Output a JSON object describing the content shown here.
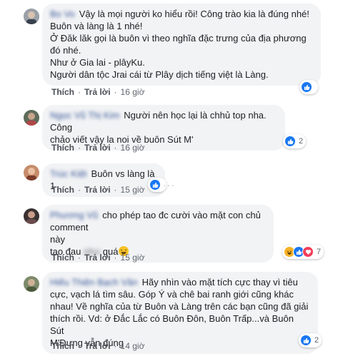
{
  "actions": {
    "like": "Thích",
    "reply": "Trả lời",
    "sep": "·"
  },
  "comments": [
    {
      "name": "Bo Vo",
      "lines": [
        "Vậy là mọi người ko hiểu rồi! Công trào kia là đúng nhé!",
        "Buôn và làng là 1 nhé!",
        "Ở Đăk lăk gọi là buôn vì theo nghĩa đặc trưng của địa phương",
        "đó nhé.",
        "Như ở Gia lai - plâyKu.",
        "Người dân tộc Jrai cái từ Plây dịch tiếng việt là Làng."
      ],
      "time": "16 giờ",
      "reaction_count": ""
    },
    {
      "name": "Ngọc Vũ Thị Kim",
      "lines": [
        "Người nên học lại là chhủ top nha. Công",
        "chảo viết vậy la noi về buôn Sút M'"
      ],
      "time": "16 giờ",
      "reaction_count": "2"
    },
    {
      "name": "Trúc Kiệt",
      "lines": [
        "Buôn vs làng là 1"
      ],
      "time": "15 giờ",
      "reaction_count": ""
    },
    {
      "name": "Phương Vũ",
      "lines_prefix": "cho phép tao đc cười vào mặt con chủ comment",
      "lines": [
        "này"
      ],
      "line3_pre": "tao đau",
      "line3_blur": "như",
      "line3_post": "quá",
      "time": "15 giờ",
      "reaction_count": "7"
    },
    {
      "name": "Hiếu Thiện Bạch Văn",
      "lines": [
        "Hãy nhìn vào mặt tích cực thay vì tiêu",
        "cực, vạch lá tìm sâu. Góp Ý và chê bai ranh giới cũng khác",
        "nhau! Về nghĩa của từ Buôn và Làng trên các bạn cũng đã giải",
        "thích rồi. Vd: ở Đắc Lắc có Buôn Đôn, Buôn Trấp...và Buôn Sút",
        "M'Đưng vẫn đúng"
      ],
      "time": "14 giờ",
      "reaction_count": "2"
    }
  ],
  "colors": {
    "link": "#385898",
    "bubble": "#f2f3f5",
    "like_blue": "#1877f2"
  },
  "icons": [
    "like-icon",
    "haha-icon",
    "love-icon",
    "more-icon",
    "laughing-emoji"
  ]
}
